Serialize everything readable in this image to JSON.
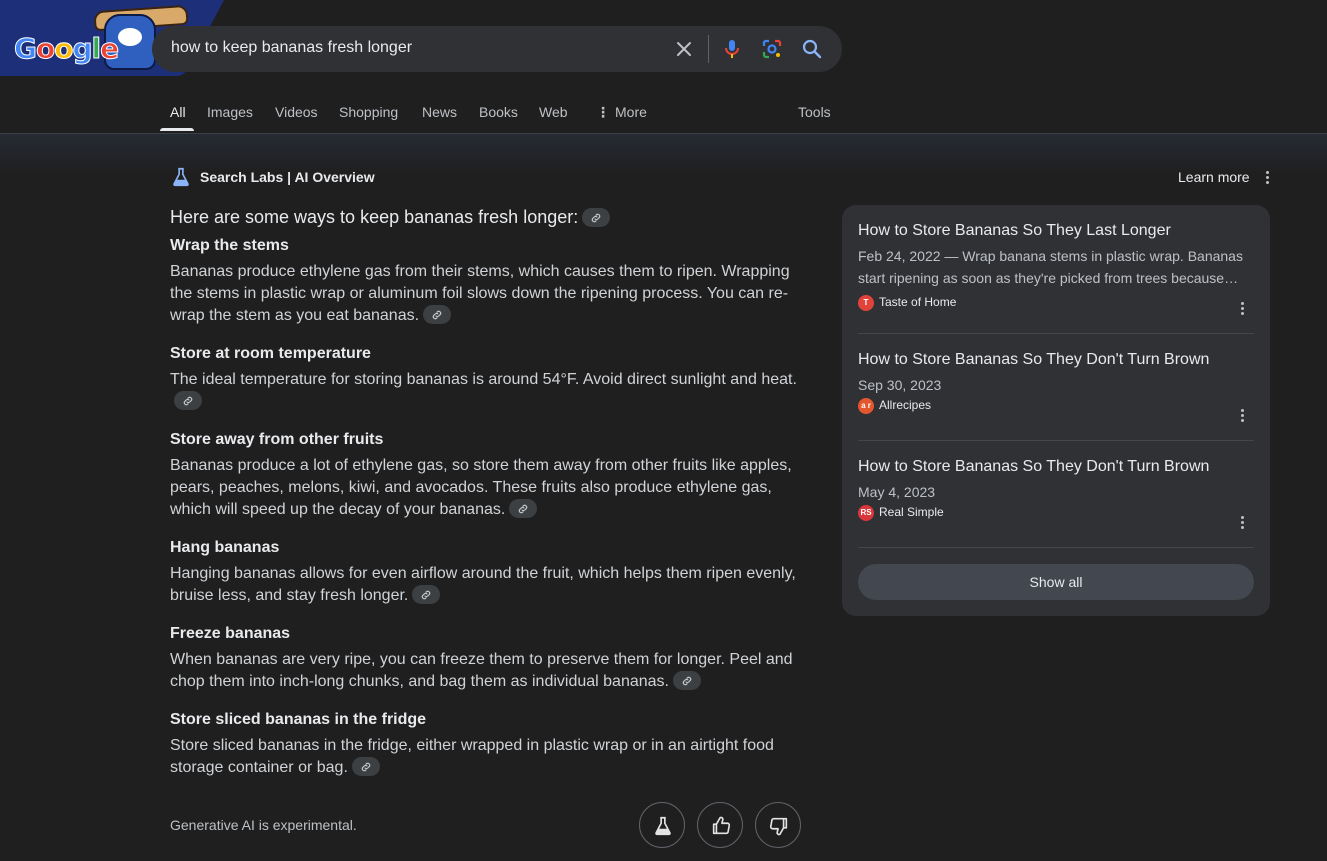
{
  "search": {
    "query": "how to keep bananas fresh longer",
    "doodle_text": "Google"
  },
  "tabs": {
    "items": [
      "All",
      "Images",
      "Videos",
      "Shopping",
      "News",
      "Books",
      "Web",
      "More"
    ],
    "active": "All",
    "tools_label": "Tools"
  },
  "ai_overview": {
    "header": "Search Labs | AI Overview",
    "learn_more": "Learn more",
    "intro": "Here are some ways to keep bananas fresh longer:",
    "sections": [
      {
        "title": "Wrap the stems",
        "text": "Bananas produce ethylene gas from their stems, which causes them to ripen. Wrapping the stems in plastic wrap or aluminum foil slows down the ripening process. You can re-wrap the stem as you eat bananas."
      },
      {
        "title": "Store at room temperature",
        "text": "The ideal temperature for storing bananas is around 54°F. Avoid direct sunlight and heat."
      },
      {
        "title": "Store away from other fruits",
        "text": "Bananas produce a lot of ethylene gas, so store them away from other fruits like apples, pears, peaches, melons, kiwi, and avocados. These fruits also produce ethylene gas, which will speed up the decay of your bananas."
      },
      {
        "title": "Hang bananas",
        "text": "Hanging bananas allows for even airflow around the fruit, which helps them ripen evenly, bruise less, and stay fresh longer."
      },
      {
        "title": "Freeze bananas",
        "text": "When bananas are very ripe, you can freeze them to preserve them for longer. Peel and chop them into inch-long chunks, and bag them as individual bananas."
      },
      {
        "title": "Store sliced bananas in the fridge",
        "text": "Store sliced bananas in the fridge, either wrapped in plastic wrap or in an airtight food storage container or bag."
      }
    ],
    "footer_note": "Generative AI is experimental."
  },
  "sources": {
    "items": [
      {
        "title": "How to Store Bananas So They Last Longer",
        "date": "Feb 24, 2022 — Wrap banana stems in plastic wrap. Bananas start ripening as soon as they're picked from trees because…",
        "site": "Taste of Home",
        "favicon_color": "#e0433a"
      },
      {
        "title": "How to Store Bananas So They Don't Turn Brown",
        "date": "Sep 30, 2023",
        "site": "Allrecipes",
        "favicon_color": "#e4572e",
        "favicon_text": "a r"
      },
      {
        "title": "How to Store Bananas So They Don't Turn Brown",
        "date": "May 4, 2023",
        "site": "Real Simple",
        "favicon_color": "#d9373b",
        "favicon_text": "RS"
      }
    ],
    "show_all": "Show all"
  }
}
